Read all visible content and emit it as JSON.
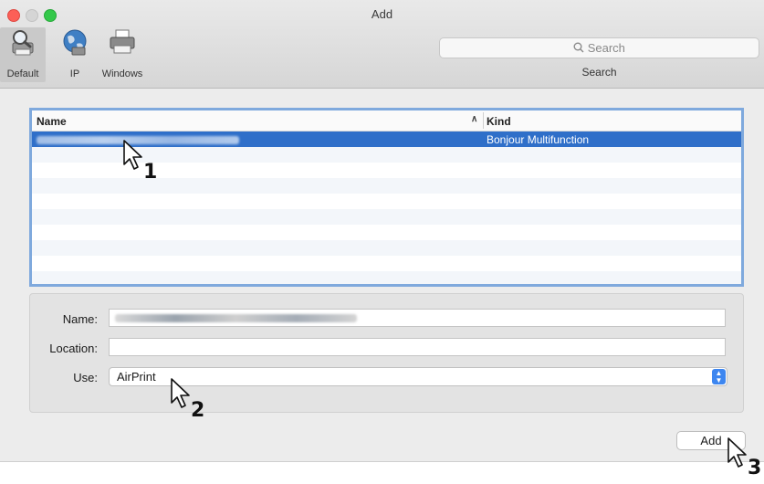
{
  "window": {
    "title": "Add"
  },
  "toolbar": {
    "items": [
      {
        "label": "Default",
        "icon": "default-printer-icon",
        "selected": true
      },
      {
        "label": "IP",
        "icon": "globe-icon",
        "selected": false
      },
      {
        "label": "Windows",
        "icon": "windows-printer-icon",
        "selected": false
      }
    ],
    "search": {
      "placeholder": "Search",
      "label": "Search",
      "icon": "search-icon"
    }
  },
  "printer_list": {
    "columns": [
      {
        "label": "Name",
        "sort": "ascending"
      },
      {
        "label": "Kind"
      }
    ],
    "rows": [
      {
        "name_blurred": true,
        "kind": "Bonjour Multifunction",
        "selected": true
      },
      {
        "name_blurred": false,
        "kind": ""
      },
      {
        "name_blurred": false,
        "kind": ""
      },
      {
        "name_blurred": false,
        "kind": ""
      },
      {
        "name_blurred": false,
        "kind": ""
      },
      {
        "name_blurred": false,
        "kind": ""
      },
      {
        "name_blurred": false,
        "kind": ""
      },
      {
        "name_blurred": false,
        "kind": ""
      },
      {
        "name_blurred": false,
        "kind": ""
      },
      {
        "name_blurred": false,
        "kind": ""
      }
    ]
  },
  "details": {
    "name_label": "Name:",
    "name_value_blurred": true,
    "location_label": "Location:",
    "location_value": "",
    "use_label": "Use:",
    "use_value": "AirPrint"
  },
  "actions": {
    "add_label": "Add"
  },
  "callouts": [
    "1",
    "2",
    "3"
  ],
  "colors": {
    "selection": "#2f6fc9",
    "table_highlight_border": "#7fa9dd",
    "select_stepper": "#3d86f0"
  }
}
